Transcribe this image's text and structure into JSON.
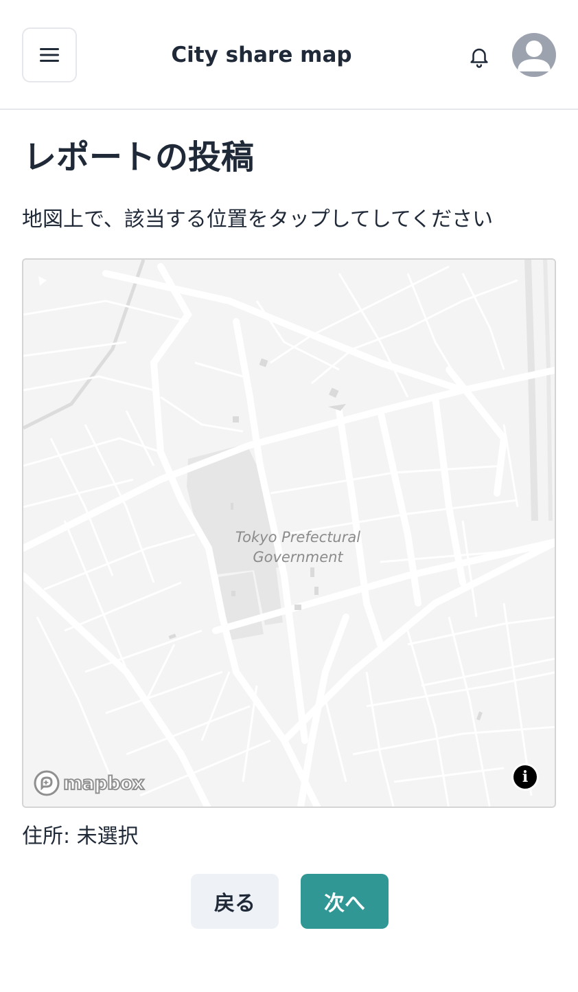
{
  "header": {
    "title": "City share map",
    "menu_icon": "hamburger-menu-icon",
    "notification_icon": "bell-icon",
    "avatar_icon": "user-avatar-icon"
  },
  "page": {
    "title": "レポートの投稿",
    "instruction": "地図上で、該当する位置をタップしてしてください"
  },
  "map": {
    "place_label_line1": "Tokyo Prefectural",
    "place_label_line2": "Government",
    "attribution_logo": "mapbox",
    "info_icon": "info-icon",
    "info_glyph": "i"
  },
  "address": {
    "text": "住所: 未選択"
  },
  "actions": {
    "back_label": "戻る",
    "next_label": "次へ"
  },
  "colors": {
    "primary": "#319795",
    "secondary_bg": "#eef2f6",
    "text": "#1f2937",
    "avatar": "#9ca3af"
  }
}
